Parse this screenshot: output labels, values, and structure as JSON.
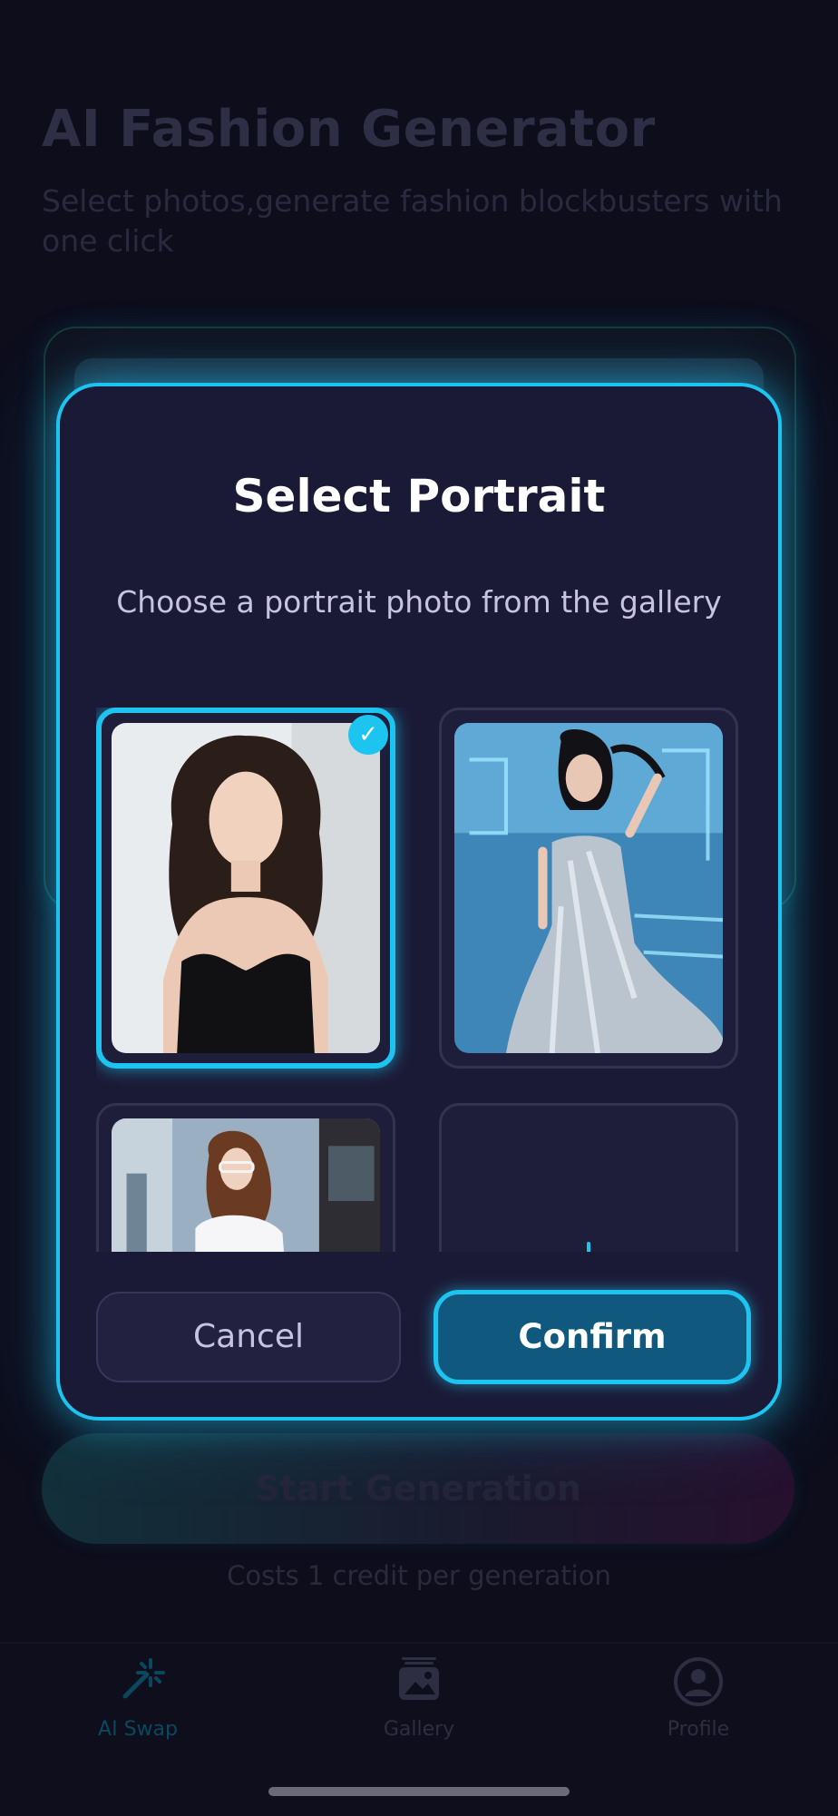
{
  "background": {
    "title": "AI Fashion Generator",
    "subtitle": "Select photos,generate fashion blockbusters with one click",
    "start_button_label": "Start Generation",
    "cost_note": "Costs 1 credit per generation"
  },
  "tabbar": {
    "items": [
      {
        "label": "AI Swap",
        "icon": "magic-wand-icon",
        "active": true
      },
      {
        "label": "Gallery",
        "icon": "gallery-icon",
        "active": false
      },
      {
        "label": "Profile",
        "icon": "profile-icon",
        "active": false
      }
    ]
  },
  "modal": {
    "title": "Select Portrait",
    "subtitle": "Choose a portrait photo from the gallery",
    "photos": [
      {
        "subject": "woman in black camisole",
        "selected": true
      },
      {
        "subject": "woman in silver sequin dress",
        "selected": false
      },
      {
        "subject": "woman in white shirt reading",
        "selected": false
      },
      {
        "subject": "add photo",
        "selected": false
      }
    ],
    "check_glyph": "✓",
    "cancel_label": "Cancel",
    "confirm_label": "Confirm"
  },
  "colors": {
    "accent": "#1ec4f0",
    "modal_bg": "#1b1a36",
    "page_bg": "#0d0d1c",
    "confirm_bg": "#10587e"
  }
}
